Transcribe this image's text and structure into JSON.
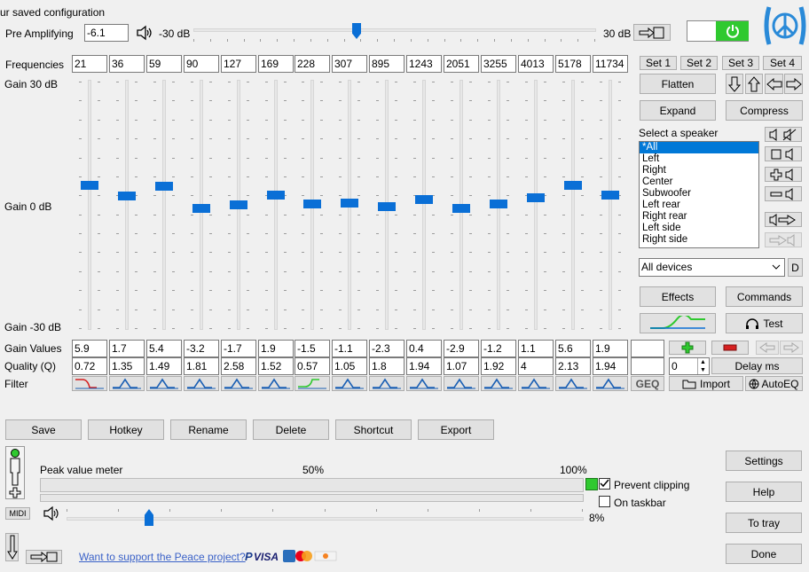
{
  "header": {
    "saved_config": "ur saved configuration",
    "pre_amp_label": "Pre Amplifying",
    "pre_amp_value": "-6.1",
    "min_db": "-30 dB",
    "max_db": "30 dB",
    "pre_amp_level": 0.405
  },
  "frequencies_label": "Frequencies",
  "frequencies": [
    "21",
    "36",
    "59",
    "90",
    "127",
    "169",
    "228",
    "307",
    "895",
    "1243",
    "2051",
    "3255",
    "4013",
    "5178",
    "11734"
  ],
  "gain_top": "Gain 30 dB",
  "gain_mid": "Gain 0 dB",
  "gain_bottom": "Gain -30 dB",
  "gain_values_label": "Gain Values",
  "gain_values": [
    "5.9",
    "1.7",
    "5.4",
    "-3.2",
    "-1.7",
    "1.9",
    "-1.5",
    "-1.1",
    "-2.3",
    "0.4",
    "-2.9",
    "-1.2",
    "1.1",
    "5.6",
    "1.9"
  ],
  "quality_label": "Quality (Q)",
  "quality_values": [
    "0.72",
    "1.35",
    "1.49",
    "1.81",
    "2.58",
    "1.52",
    "0.57",
    "1.05",
    "1.8",
    "1.94",
    "1.07",
    "1.92",
    "4",
    "2.13",
    "1.94"
  ],
  "filter_label": "Filter",
  "sets": [
    "Set 1",
    "Set 2",
    "Set 3",
    "Set 4"
  ],
  "buttons": {
    "flatten": "Flatten",
    "expand": "Expand",
    "compress": "Compress",
    "effects": "Effects",
    "commands": "Commands",
    "test": "Test",
    "delay": "Delay ms",
    "geq": "GEQ",
    "import": "Import",
    "autoeq": "AutoEQ",
    "d": "D",
    "save": "Save",
    "hotkey": "Hotkey",
    "rename": "Rename",
    "delete": "Delete",
    "shortcut": "Shortcut",
    "export": "Export",
    "settings": "Settings",
    "help": "Help",
    "totray": "To tray",
    "done": "Done",
    "midi": "MIDI"
  },
  "speaker": {
    "label": "Select a speaker",
    "items": [
      "*All",
      "Left",
      "Right",
      "Center",
      "Subwoofer",
      "Left rear",
      "Right rear",
      "Left side",
      "Right side"
    ],
    "selected": 0
  },
  "devices_value": "All devices",
  "delay_value": "0",
  "meter": {
    "label": "Peak value meter",
    "pct50": "50%",
    "pct100": "100%",
    "prevent_clipping": "Prevent clipping",
    "on_taskbar": "On taskbar",
    "volume_pct": "8%",
    "volume_level": 0.08
  },
  "support_link": "Want to support the Peace project?",
  "colors": {
    "accent": "#0a6fd6",
    "power": "#2fc92f",
    "link": "#3b62c8",
    "logo": "#2a8ad8"
  }
}
